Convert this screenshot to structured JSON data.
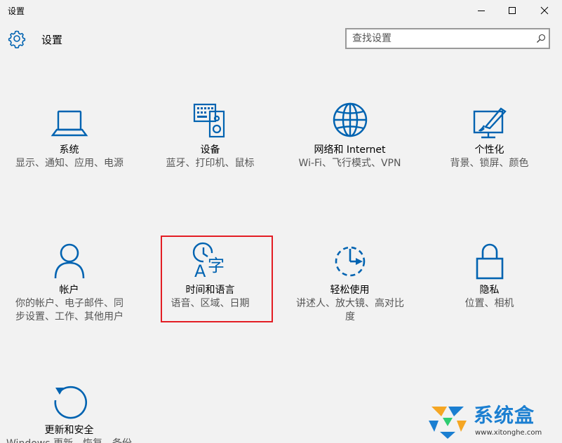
{
  "window": {
    "title": "设置"
  },
  "header": {
    "title": "设置",
    "icon": "gear-icon"
  },
  "search": {
    "placeholder": "查找设置",
    "value": ""
  },
  "tiles": [
    {
      "title": "系统",
      "desc": "显示、通知、应用、电源",
      "icon": "laptop-icon"
    },
    {
      "title": "设备",
      "desc": "蓝牙、打印机、鼠标",
      "icon": "keyboard-speaker-icon"
    },
    {
      "title": "网络和 Internet",
      "desc": "Wi-Fi、飞行模式、VPN",
      "icon": "globe-icon"
    },
    {
      "title": "个性化",
      "desc": "背景、锁屏、颜色",
      "icon": "paint-monitor-icon"
    },
    {
      "title": "帐户",
      "desc": "你的帐户、电子邮件、同步设置、工作、其他用户",
      "icon": "person-icon"
    },
    {
      "title": "时间和语言",
      "desc": "语音、区域、日期",
      "icon": "clock-language-icon"
    },
    {
      "title": "轻松使用",
      "desc": "讲述人、放大镜、高对比度",
      "icon": "ease-of-access-icon"
    },
    {
      "title": "隐私",
      "desc": "位置、相机",
      "icon": "lock-icon"
    },
    {
      "title": "更新和安全",
      "desc": "Windows 更新、恢复、备份",
      "icon": "refresh-icon"
    }
  ],
  "watermark": {
    "brand": "系统盒",
    "url": "www.xitonghe.com"
  },
  "colors": {
    "accent": "#0063b1",
    "highlight": "#e31d24",
    "background": "#f2f2f2"
  }
}
